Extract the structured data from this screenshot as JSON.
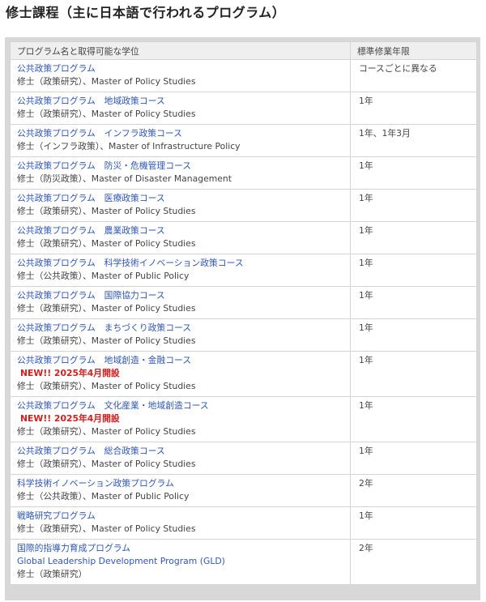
{
  "page_title": "修士課程（主に日本語で行われるプログラム）",
  "table": {
    "headers": [
      "プログラム名と取得可能な学位",
      "標準修業年限"
    ],
    "rows": [
      {
        "program": "公共政策プログラム",
        "degree": "修士（政策研究）、Master of Policy Studies",
        "years": "コースごとに異なる"
      },
      {
        "program": "公共政策プログラム　地域政策コース",
        "degree": "修士（政策研究）、Master of Policy Studies",
        "years": "1年"
      },
      {
        "program": "公共政策プログラム　インフラ政策コース",
        "degree": "修士（インフラ政策）、Master of Infrastructure Policy",
        "years": " 1年、1年3月"
      },
      {
        "program": "公共政策プログラム　防災・危機管理コース",
        "degree": "修士（防災政策）、Master of Disaster Management",
        "years": "1年"
      },
      {
        "program": "公共政策プログラム　医療政策コース",
        "degree": "修士（政策研究）、Master of Policy Studies",
        "years": "1年"
      },
      {
        "program": "公共政策プログラム　農業政策コース",
        "degree": "修士（政策研究）、Master of Policy Studies",
        "years": "1年"
      },
      {
        "program": "公共政策プログラム　科学技術イノベーション政策コース",
        "degree": "修士（公共政策）、Master of Public Policy",
        "years": "1年"
      },
      {
        "program": "公共政策プログラム　国際協力コース",
        "degree": "修士（政策研究）、Master of Policy Studies",
        "years": "1年"
      },
      {
        "program": "公共政策プログラム　まちづくり政策コース",
        "degree": "修士（政策研究）、Master of Policy Studies",
        "years": "1年"
      },
      {
        "program": "公共政策プログラム　地域創造・金融コース",
        "new": "NEW!! 2025年4月開設",
        "degree": "修士（政策研究）、Master of Policy Studies",
        "years": "1年"
      },
      {
        "program": "公共政策プログラム　文化産業・地域創造コース",
        "new": "NEW!! 2025年4月開設",
        "degree": "修士（政策研究）、Master of Policy Studies",
        "years": "1年"
      },
      {
        "program": "公共政策プログラム　総合政策コース",
        "degree": "修士（政策研究）、Master of Policy Studies",
        "years": "1年"
      },
      {
        "program": "科学技術イノベーション政策プログラム",
        "degree": "修士（公共政策）、Master of Public Policy",
        "years": "2年"
      },
      {
        "program": "戦略研究プログラム",
        "degree": "修士（政策研究）、Master of Policy Studies",
        "years": "1年"
      },
      {
        "program": "国際的指導力育成プログラム",
        "program_en": "Global Leadership Development Program (GLD)",
        "degree": "修士（政策研究）",
        "years": "2年"
      }
    ]
  }
}
